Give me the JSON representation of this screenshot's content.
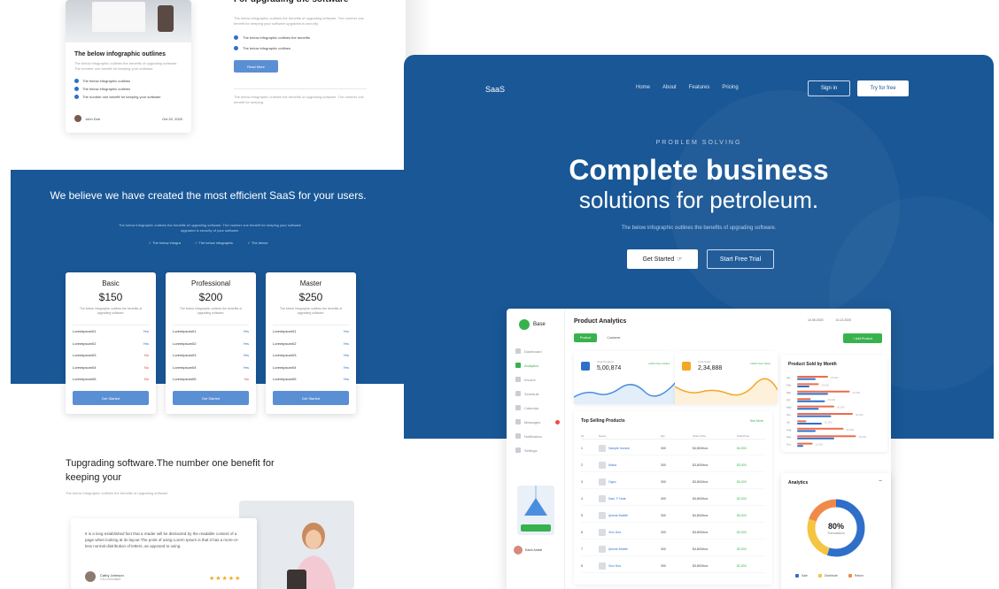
{
  "left": {
    "blog_card": {
      "title": "The below infographic outlines",
      "desc": "The below infographic outlines the benefits of upgrading software. The number one benefit for keeping your software",
      "items": [
        "The below infographic outlines",
        "The below infographic outlines",
        "The number one benefit for keeping your software"
      ],
      "author": "John Doe",
      "date": "Oct 20, 2020"
    },
    "feature": {
      "heading": "For upgrading the software",
      "desc": "The below infographic outlines the benefits of upgrading software. The number one benefit for keeping your software upgraded is security.",
      "items": [
        "The below infographic outlines the benefits",
        "The below infographic outlines"
      ],
      "button": "Read More",
      "note": "The below infographic outlines the benefits of upgrading software. The number one benefit for keeping."
    },
    "band": {
      "title": "We believe we have created the most efficient SaaS for your users.",
      "sub": "The below infographic outlines the benefits of upgrading software. The number one benefit for keeping your software upgraded is security of your software.",
      "checks": [
        "The below infogra",
        "The below infographic",
        "The below"
      ]
    },
    "pricing": [
      {
        "name": "Basic",
        "price": "$150",
        "desc": "The below infographic outlines the benefits of upgrading software.",
        "rows": [
          {
            "label": "Loremipsum01",
            "value": "Yes"
          },
          {
            "label": "Loremipsum02",
            "value": "Yes"
          },
          {
            "label": "Loremipsum03",
            "value": "No"
          },
          {
            "label": "Loremipsum04",
            "value": "No"
          },
          {
            "label": "Loremipsum05",
            "value": "No"
          }
        ],
        "button": "Get Started"
      },
      {
        "name": "Professional",
        "price": "$200",
        "desc": "The below infographic outlines the benefits of upgrading software.",
        "rows": [
          {
            "label": "Loremipsum01",
            "value": "Yes"
          },
          {
            "label": "Loremipsum02",
            "value": "Yes"
          },
          {
            "label": "Loremipsum03",
            "value": "Yes"
          },
          {
            "label": "Loremipsum04",
            "value": "Yes"
          },
          {
            "label": "Loremipsum05",
            "value": "No"
          }
        ],
        "button": "Get Started"
      },
      {
        "name": "Master",
        "price": "$250",
        "desc": "The below infographic outlines the benefits of upgrading software.",
        "rows": [
          {
            "label": "Loremipsum01",
            "value": "Yes"
          },
          {
            "label": "Loremipsum02",
            "value": "Yes"
          },
          {
            "label": "Loremipsum03",
            "value": "Yes"
          },
          {
            "label": "Loremipsum04",
            "value": "Yes"
          },
          {
            "label": "Loremipsum05",
            "value": "Yes"
          }
        ],
        "button": "Get Started"
      }
    ],
    "testimonial": {
      "title": "Tupgrading software.The number one benefit for keeping your",
      "sub": "The below infographic outlines the benefits of upgrading software.",
      "quote": "It is a long established fact that a reader will be distracted by the readable content of a page when looking at its layout.The point of using Lorem Ipsum is that it has a more-or-less normal distribution of letters, as opposed to using.",
      "name": "Cathy Johnson",
      "role": "Ceo consultant",
      "stars": "★★★★★"
    }
  },
  "right": {
    "logo": "SaaS",
    "nav": [
      "Home",
      "About",
      "Features",
      "Pricing"
    ],
    "signin": "Sign in",
    "try": "Try for free",
    "eyebrow": "PROBLEM SOLVING",
    "h1": "Complete business",
    "h2": "solutions for petroleum.",
    "desc": "The below infographic outlines the benefits of upgrading software.",
    "get_started": "Get Started",
    "free_trial": "Start Free Trial",
    "dashboard": {
      "logo": "Base",
      "menu": [
        "Dashboard",
        "Analytics",
        "Invoice",
        "Schedule",
        "Calendar",
        "Messages",
        "Notification",
        "Settings"
      ],
      "user": "Easin Arafat",
      "title": "Product Analytics",
      "dates": [
        "10.06.2020",
        "10.12.2020"
      ],
      "tabs": [
        "Product",
        "Customer"
      ],
      "add_button": "+ Add Product",
      "stats": [
        {
          "label": "Total Products",
          "value": "5,00,874",
          "tag": "+1400 New Added"
        },
        {
          "label": "Total Sales",
          "value": "2,34,888",
          "tag": "+3400 New Sales"
        }
      ],
      "table": {
        "title": "Top Selling Products",
        "more": "See More",
        "headers": [
          "SL",
          "Name",
          "Qty",
          "Order Price",
          "Total Price"
        ],
        "rows": [
          {
            "no": "1",
            "name": "Sample Invoice",
            "qty": "300",
            "price": "$4,800/box",
            "total": "$4,000"
          },
          {
            "no": "2",
            "name": "Nokia",
            "qty": "300",
            "price": "$3,800/box",
            "total": "$3,000"
          },
          {
            "no": "3",
            "name": "Oppo",
            "qty": "300",
            "price": "$3,800/box",
            "total": "$3,000"
          },
          {
            "no": "4",
            "name": "Sam. F Note",
            "qty": "300",
            "price": "$3,800/box",
            "total": "$2,000"
          },
          {
            "no": "5",
            "name": "Iphone Mobile",
            "qty": "300",
            "price": "$4,800/box",
            "total": "$3,000"
          },
          {
            "no": "6",
            "name": "Vivo Dos",
            "qty": "300",
            "price": "$3,800/box",
            "total": "$2,000"
          },
          {
            "no": "7",
            "name": "Iphone Mobile",
            "qty": "300",
            "price": "$4,800/box",
            "total": "$3,000"
          },
          {
            "no": "8",
            "name": "Vivo Dos",
            "qty": "300",
            "price": "$3,800/box",
            "total": "$2,000"
          }
        ]
      },
      "region": {
        "title": "Product Sold by Month",
        "labels": [
          "Jan",
          "Feb",
          "Mar",
          "Apr",
          "May",
          "Jun",
          "Jul",
          "Aug",
          "Sep",
          "Oct"
        ],
        "bars_red": [
          0.5,
          0.35,
          0.85,
          0.22,
          0.6,
          0.9,
          0.15,
          0.75,
          0.95,
          0.25
        ],
        "bars_blue": [
          0.3,
          0.2,
          0.5,
          0.45,
          0.35,
          0.55,
          0.4,
          0.3,
          0.6,
          0.1
        ],
        "values": [
          "25,000",
          "20,000",
          "40,000",
          "15,000",
          "30,000",
          "45,000",
          "10,000",
          "35,000",
          "48,000",
          "12,000"
        ]
      },
      "analytics": {
        "title": "Analytics",
        "percent": "80%",
        "caption": "Transactions",
        "legend": [
          "Sale",
          "Distribute",
          "Return"
        ],
        "colors": [
          "#2f6fc9",
          "#f5c542",
          "#f08a4b"
        ],
        "shares": [
          0.55,
          0.25,
          0.2
        ]
      }
    }
  }
}
